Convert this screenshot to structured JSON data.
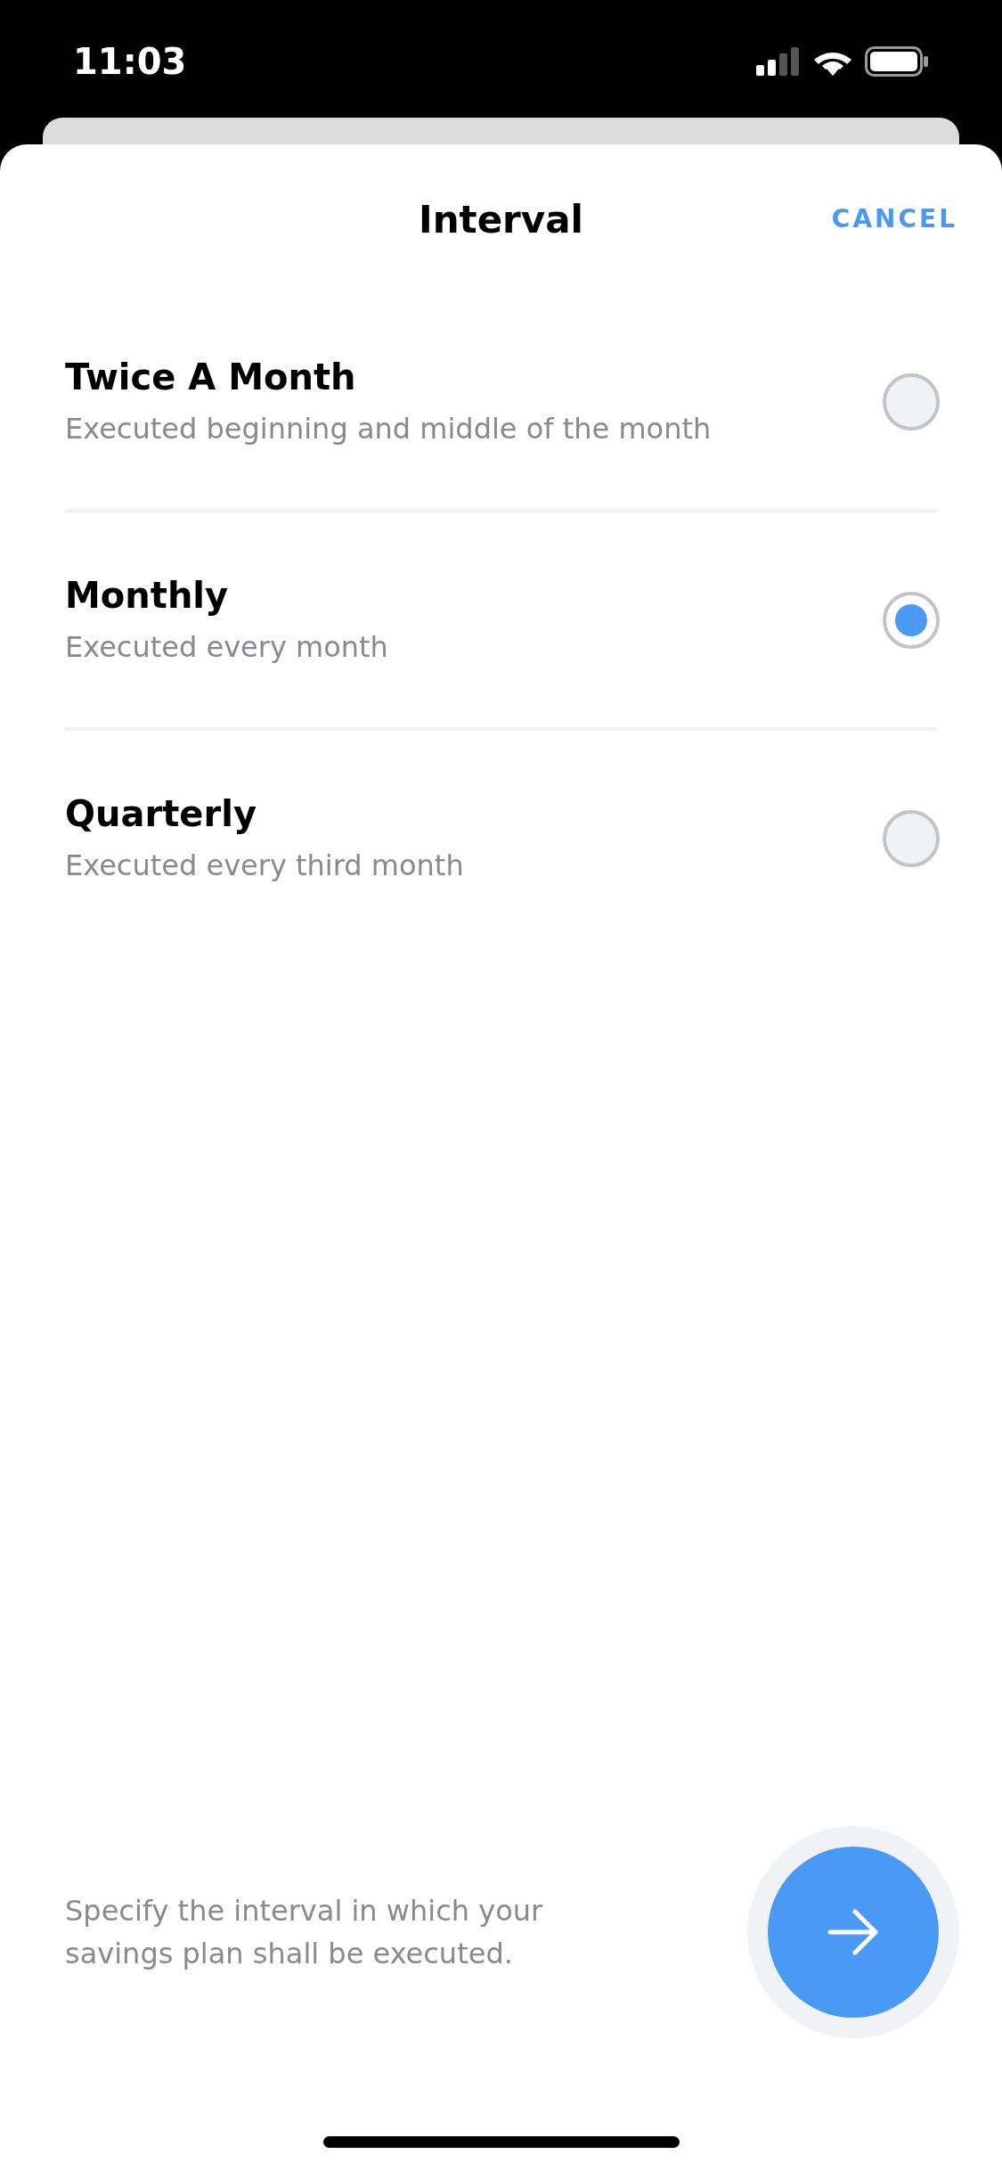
{
  "status_bar": {
    "time": "11:03"
  },
  "header": {
    "title": "Interval",
    "cancel": "CANCEL"
  },
  "options": [
    {
      "title": "Twice A Month",
      "description": "Executed beginning and middle of the month",
      "selected": false
    },
    {
      "title": "Monthly",
      "description": "Executed every month",
      "selected": true
    },
    {
      "title": "Quarterly",
      "description": "Executed every third month",
      "selected": false
    }
  ],
  "footer": {
    "hint": "Specify the interval in which your savings plan shall be executed."
  }
}
